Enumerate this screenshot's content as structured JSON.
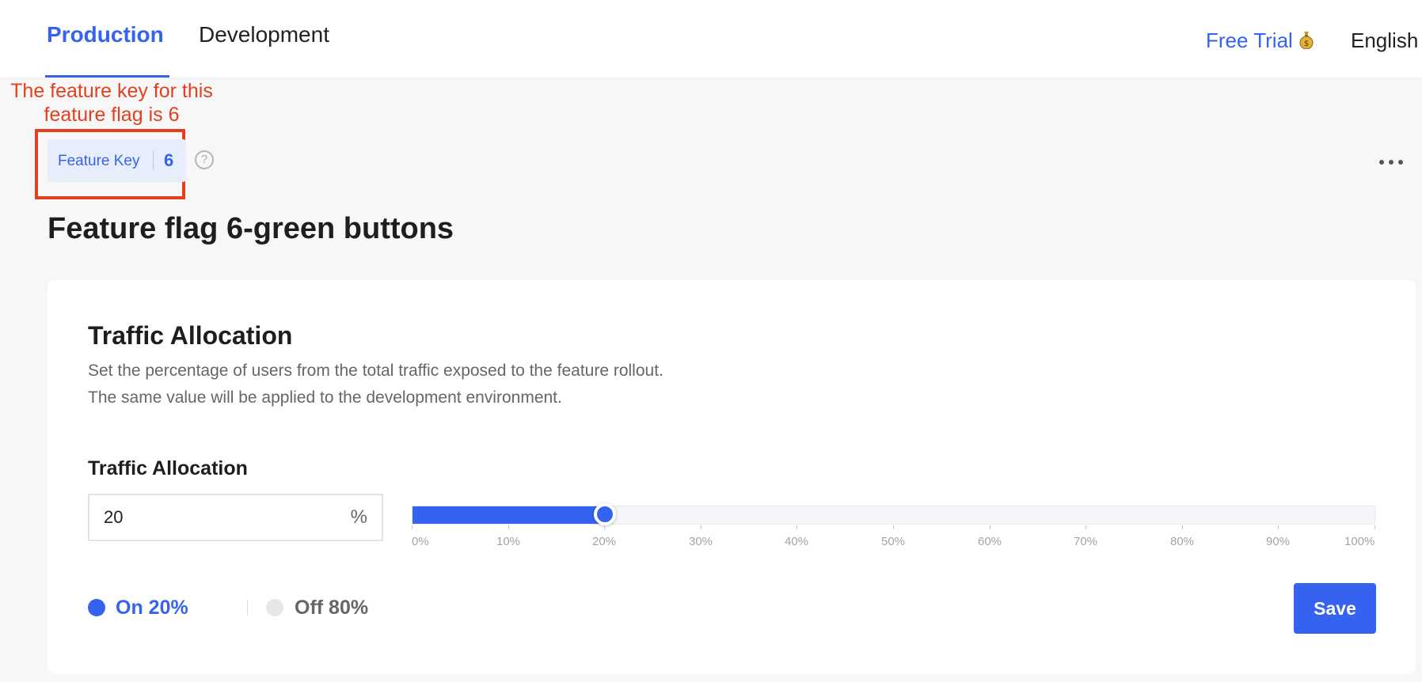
{
  "nav": {
    "tabs": [
      {
        "label": "Production",
        "active": true
      },
      {
        "label": "Development",
        "active": false
      }
    ],
    "free_trial_label": "Free Trial",
    "free_trial_icon": "moneybag-icon",
    "language_label": "English"
  },
  "annotation": {
    "text": "The feature key for this feature flag is 6",
    "color": "#e3401f"
  },
  "feature_key": {
    "label": "Feature Key",
    "value": "6",
    "help_icon": "?"
  },
  "page": {
    "title": "Feature flag 6-green buttons"
  },
  "traffic": {
    "section_title": "Traffic Allocation",
    "description_line1": "Set the percentage of users from the total traffic exposed to the feature rollout.",
    "description_line2": "The same value will be applied to the development environment.",
    "field_label": "Traffic Allocation",
    "input_value": "20",
    "input_suffix": "%",
    "slider_value_percent": 20,
    "ticks": [
      "0%",
      "10%",
      "20%",
      "30%",
      "40%",
      "50%",
      "60%",
      "70%",
      "80%",
      "90%",
      "100%"
    ],
    "on_label": "On 20%",
    "off_label": "Off 80%",
    "save_label": "Save"
  },
  "colors": {
    "accent": "#3563f0",
    "off_dot": "#e6e6e6"
  }
}
